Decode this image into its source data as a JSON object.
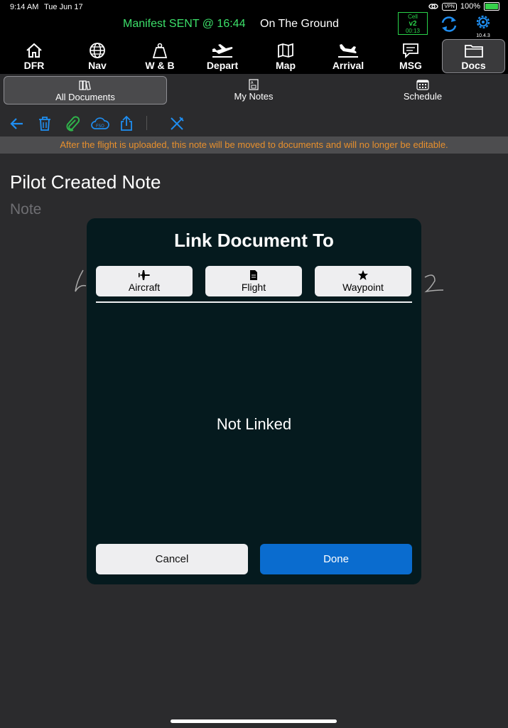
{
  "status": {
    "time": "9:14 AM",
    "date": "Tue Jun 17",
    "vpn": "VPN",
    "battery": "100%"
  },
  "topbar": {
    "manifest": "Manifest SENT @ 16:44",
    "phase": "On The Ground",
    "cell": {
      "label": "Cell",
      "version": "v2",
      "time": "00:13"
    },
    "app_version": "10.4.3",
    "colors": {
      "manifest": "#3ce06a",
      "accent": "#1f8ef1"
    }
  },
  "nav": {
    "items": [
      {
        "label": "DFR",
        "icon": "home-icon"
      },
      {
        "label": "Nav",
        "icon": "globe-icon"
      },
      {
        "label": "W & B",
        "icon": "weight-icon"
      },
      {
        "label": "Depart",
        "icon": "takeoff-icon"
      },
      {
        "label": "Map",
        "icon": "map-icon"
      },
      {
        "label": "Arrival",
        "icon": "landing-icon"
      },
      {
        "label": "MSG",
        "icon": "message-icon"
      },
      {
        "label": "Docs",
        "icon": "folder-icon"
      }
    ],
    "active": "Docs"
  },
  "subtabs": {
    "items": [
      {
        "label": "All Documents",
        "icon": "books-icon"
      },
      {
        "label": "My Notes",
        "icon": "note-icon"
      },
      {
        "label": "Schedule",
        "icon": "calendar-icon"
      }
    ],
    "active": "All Documents"
  },
  "toolbar": {
    "icons": [
      "back-arrow-icon",
      "trash-icon",
      "paperclip-icon",
      "cloud-fso-icon",
      "share-icon",
      "crossed-tools-icon"
    ],
    "fso": "FSO"
  },
  "warning": "After the flight is uploaded, this note will be moved to documents and will no longer be editable.",
  "note": {
    "title": "Pilot Created Note",
    "subtitle": "Note"
  },
  "modal": {
    "title": "Link Document To",
    "options": [
      {
        "label": "Aircraft",
        "icon": "airplane-icon"
      },
      {
        "label": "Flight",
        "icon": "document-icon"
      },
      {
        "label": "Waypoint",
        "icon": "star-icon"
      }
    ],
    "status": "Not Linked",
    "cancel_label": "Cancel",
    "done_label": "Done"
  }
}
